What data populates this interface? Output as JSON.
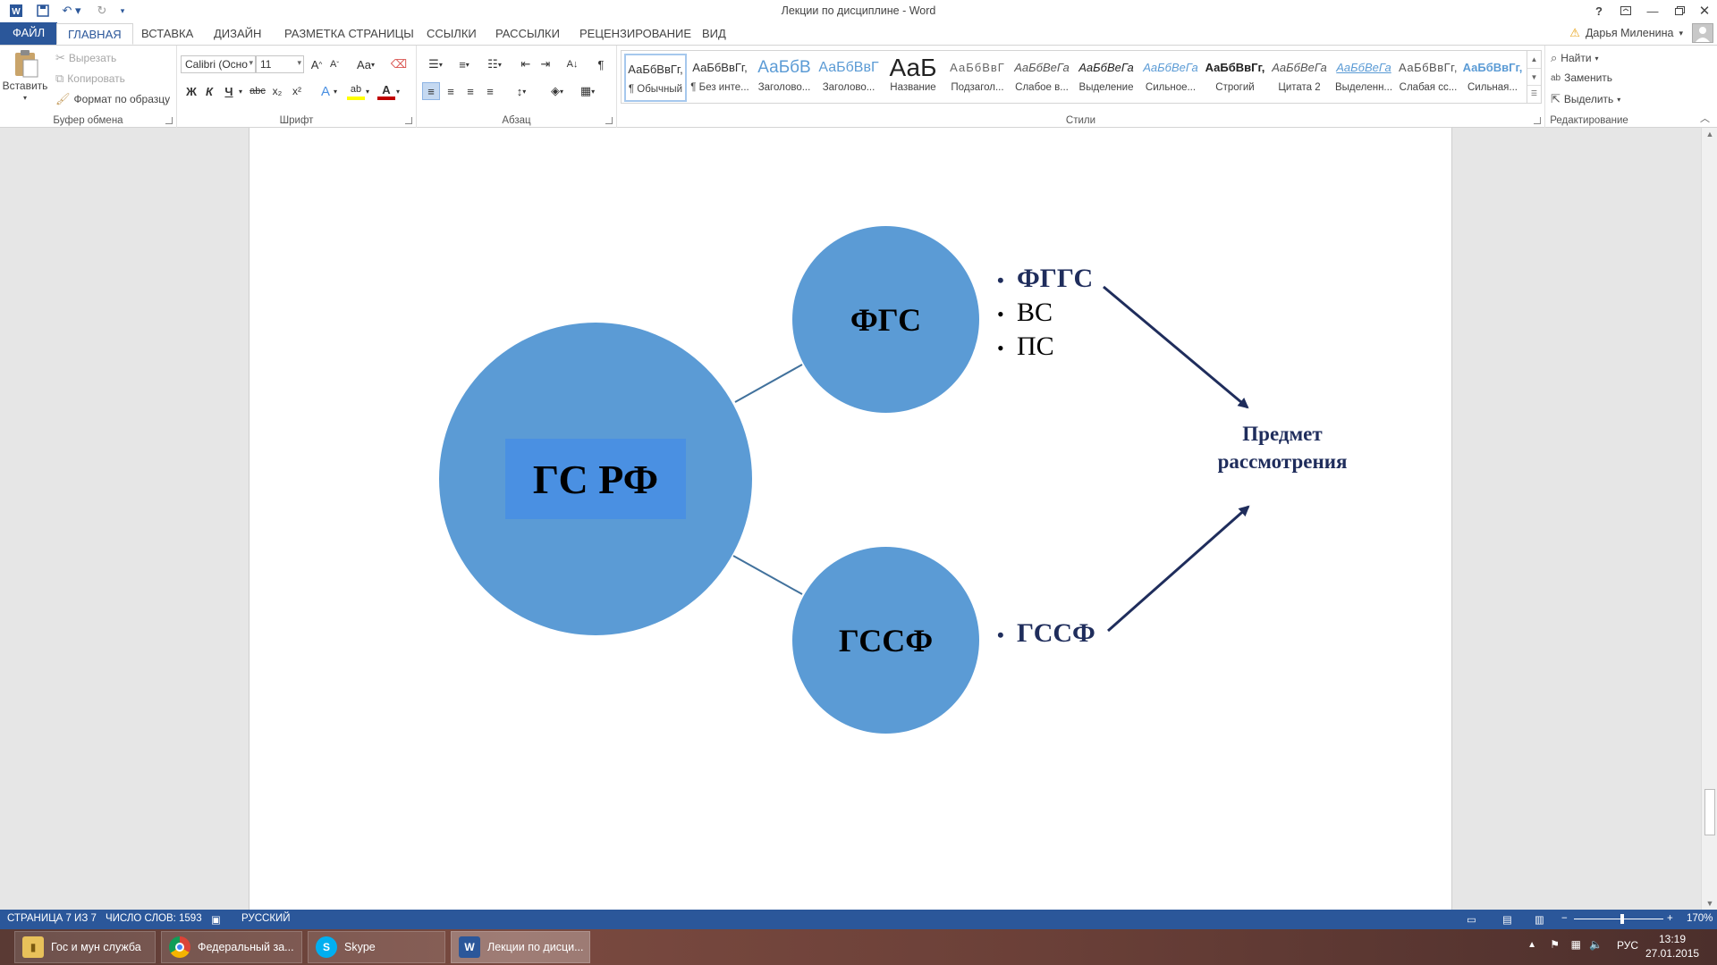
{
  "titlebar": {
    "title": "Лекции по дисциплине - Word",
    "icons": [
      "word-logo-icon",
      "save-icon",
      "undo-icon",
      "redo-icon",
      "customize-qat-icon"
    ],
    "window_buttons": [
      "?",
      "restore-ribbon",
      "minimize",
      "maximize",
      "close"
    ]
  },
  "tabs": [
    "ФАЙЛ",
    "ГЛАВНАЯ",
    "ВСТАВКА",
    "ДИЗАЙН",
    "РАЗМЕТКА СТРАНИЦЫ",
    "ССЫЛКИ",
    "РАССЫЛКИ",
    "РЕЦЕНЗИРОВАНИЕ",
    "ВИД"
  ],
  "active_tab": "ГЛАВНАЯ",
  "user": {
    "name": "Дарья Миленина"
  },
  "ribbon": {
    "clipboard": {
      "label": "Буфер обмена",
      "paste": "Вставить",
      "cut": "Вырезать",
      "copy": "Копировать",
      "format_painter": "Формат по образцу"
    },
    "font": {
      "label": "Шрифт",
      "font_name": "Calibri (Осно",
      "font_size": "11",
      "grow": "A",
      "shrink": "A",
      "change_case": "Aa",
      "bold": "Ж",
      "italic": "К",
      "underline": "Ч",
      "strike": "abc",
      "subscript": "x₂",
      "superscript": "x²",
      "text_effects": "A",
      "highlight": "ab",
      "font_color": "A"
    },
    "paragraph": {
      "label": "Абзац",
      "pilcrow": "¶"
    },
    "styles": {
      "label": "Стили",
      "items": [
        {
          "preview": "АаБбВвГг,",
          "name": "¶ Обычный"
        },
        {
          "preview": "АаБбВвГг,",
          "name": "¶ Без инте..."
        },
        {
          "preview": "АаБбВ",
          "name": "Заголово..."
        },
        {
          "preview": "АаБбВвГ",
          "name": "Заголово..."
        },
        {
          "preview": "АаБ",
          "name": "Название"
        },
        {
          "preview": "АаБбВвГ",
          "name": "Подзагол..."
        },
        {
          "preview": "АаБбВеГа",
          "name": "Слабое в..."
        },
        {
          "preview": "АаБбВеГа",
          "name": "Выделение"
        },
        {
          "preview": "АаБбВеГа",
          "name": "Сильное..."
        },
        {
          "preview": "АаБбВвГг,",
          "name": "Строгий"
        },
        {
          "preview": "АаБбВеГа",
          "name": "Цитата 2"
        },
        {
          "preview": "АаБбВеГа",
          "name": "Выделенн..."
        },
        {
          "preview": "АаБбВвГг,",
          "name": "Слабая сс..."
        },
        {
          "preview": "АаБбВвГг,",
          "name": "Сильная..."
        }
      ]
    },
    "editing": {
      "label": "Редактирование",
      "find": "Найти",
      "replace": "Заменить",
      "select": "Выделить"
    }
  },
  "diagram": {
    "main_circle": "ГС РФ",
    "circle_top": "ФГС",
    "circle_bottom": "ГССФ",
    "bullets_top": [
      {
        "text": "ФГГС",
        "bold": true
      },
      {
        "text": "ВС",
        "bold": false
      },
      {
        "text": "ПС",
        "bold": false
      }
    ],
    "bullets_bottom": [
      {
        "text": "ГССФ",
        "bold": true
      }
    ],
    "subject_line1": "Предмет",
    "subject_line2": "рассмотрения",
    "colors": {
      "circle": "#5b9bd5",
      "main_label_bg": "#4a90e2",
      "arrow": "#1f2d5c",
      "connector": "#41719c"
    }
  },
  "statusbar": {
    "page": "СТРАНИЦА 7 ИЗ 7",
    "words": "ЧИСЛО СЛОВ: 1593",
    "language": "РУССКИЙ",
    "zoom": "170%"
  },
  "taskbar": {
    "items": [
      {
        "label": "Гос и мун служба",
        "icon": "folder-icon"
      },
      {
        "label": "Федеральный за...",
        "icon": "chrome-icon"
      },
      {
        "label": "Skype",
        "icon": "skype-icon"
      },
      {
        "label": "Лекции по дисци...",
        "icon": "word-icon"
      }
    ],
    "lang": "РУС",
    "time": "13:19",
    "date": "27.01.2015"
  }
}
